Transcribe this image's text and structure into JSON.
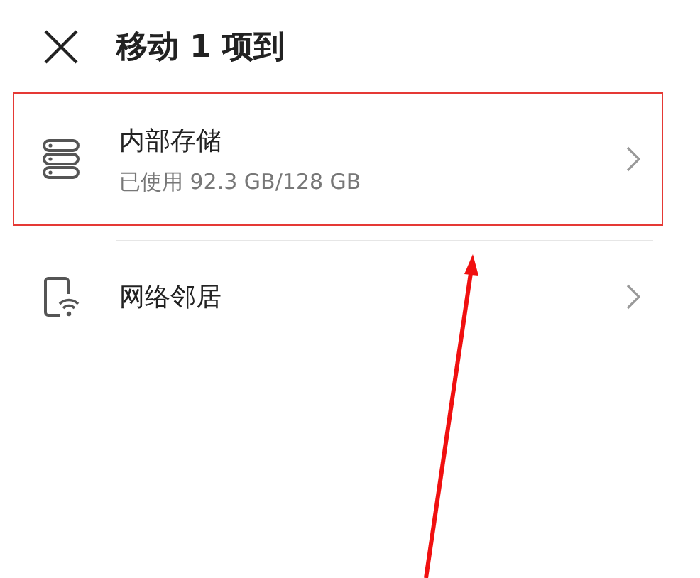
{
  "header": {
    "title": "移动 1 项到"
  },
  "locations": [
    {
      "kind": "storage",
      "name": "内部存储",
      "detail": "已使用 92.3 GB/128 GB",
      "highlighted": true
    },
    {
      "kind": "network",
      "name": "网络邻居",
      "highlighted": false
    }
  ]
}
